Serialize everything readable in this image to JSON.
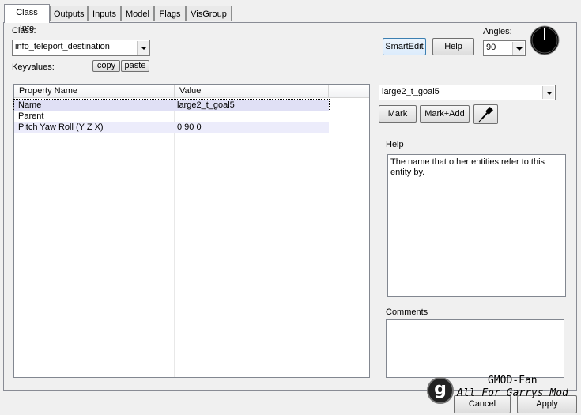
{
  "tabs": [
    {
      "label": "Class Info",
      "active": true
    },
    {
      "label": "Outputs"
    },
    {
      "label": "Inputs"
    },
    {
      "label": "Model"
    },
    {
      "label": "Flags"
    },
    {
      "label": "VisGroup"
    }
  ],
  "class_label": "Class:",
  "class_value": "info_teleport_destination",
  "keyvalues_label": "Keyvalues:",
  "copy_label": "copy",
  "paste_label": "paste",
  "smartedit_label": "SmartEdit",
  "help_button_label": "Help",
  "angles_label": "Angles:",
  "angles_value": "90",
  "table": {
    "col_property": "Property Name",
    "col_value": "Value",
    "rows": [
      {
        "name": "Name",
        "value": "large2_t_goal5"
      },
      {
        "name": "Parent",
        "value": ""
      },
      {
        "name": "Pitch Yaw Roll (Y Z X)",
        "value": "0 90 0"
      }
    ]
  },
  "target_value": "large2_t_goal5",
  "mark_label": "Mark",
  "mark_add_label": "Mark+Add",
  "help_group_label": "Help",
  "help_text": "The name that other entities refer to this entity by.",
  "comments_label": "Comments",
  "comments_text": "",
  "cancel_label": "Cancel",
  "apply_label": "Apply",
  "watermark": {
    "line1": "GMOD-Fan",
    "line2": "All For Garrys Mod",
    "logo_letter": "g"
  }
}
